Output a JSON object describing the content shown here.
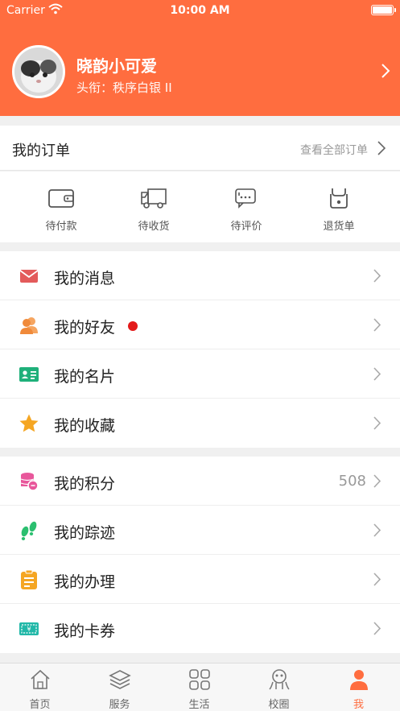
{
  "status_bar": {
    "carrier": "Carrier",
    "time": "10:00 AM"
  },
  "profile": {
    "name": "晓韵小可爱",
    "title_row": "头衔：秩序白银 II"
  },
  "orders": {
    "title": "我的订单",
    "view_all": "查看全部订单",
    "items": [
      {
        "label": "待付款",
        "icon": "wallet-icon"
      },
      {
        "label": "待收货",
        "icon": "truck-icon"
      },
      {
        "label": "待评价",
        "icon": "chat-icon"
      },
      {
        "label": "退货单",
        "icon": "return-icon"
      }
    ]
  },
  "menu1": [
    {
      "label": "我的消息",
      "icon": "mail-icon",
      "color": "#e35b5b"
    },
    {
      "label": "我的好友",
      "icon": "friends-icon",
      "color": "#f08a3a",
      "badge": true
    },
    {
      "label": "我的名片",
      "icon": "card-icon",
      "color": "#1fb07a"
    },
    {
      "label": "我的收藏",
      "icon": "star-icon",
      "color": "#f5a623"
    }
  ],
  "menu2": [
    {
      "label": "我的积分",
      "icon": "coins-icon",
      "color": "#e8579b",
      "value": "508"
    },
    {
      "label": "我的踪迹",
      "icon": "footprint-icon",
      "color": "#2bbf6f"
    },
    {
      "label": "我的办理",
      "icon": "clipboard-icon",
      "color": "#f5a623"
    },
    {
      "label": "我的卡券",
      "icon": "ticket-icon",
      "color": "#22b8a8"
    }
  ],
  "tabbar": [
    {
      "label": "首页",
      "icon": "home-icon"
    },
    {
      "label": "服务",
      "icon": "layers-icon"
    },
    {
      "label": "生活",
      "icon": "grid-icon"
    },
    {
      "label": "校圈",
      "icon": "campus-icon"
    },
    {
      "label": "我",
      "icon": "user-icon",
      "active": true
    }
  ],
  "colors": {
    "brand": "#ff6d3f",
    "badge": "#e31a1a"
  }
}
